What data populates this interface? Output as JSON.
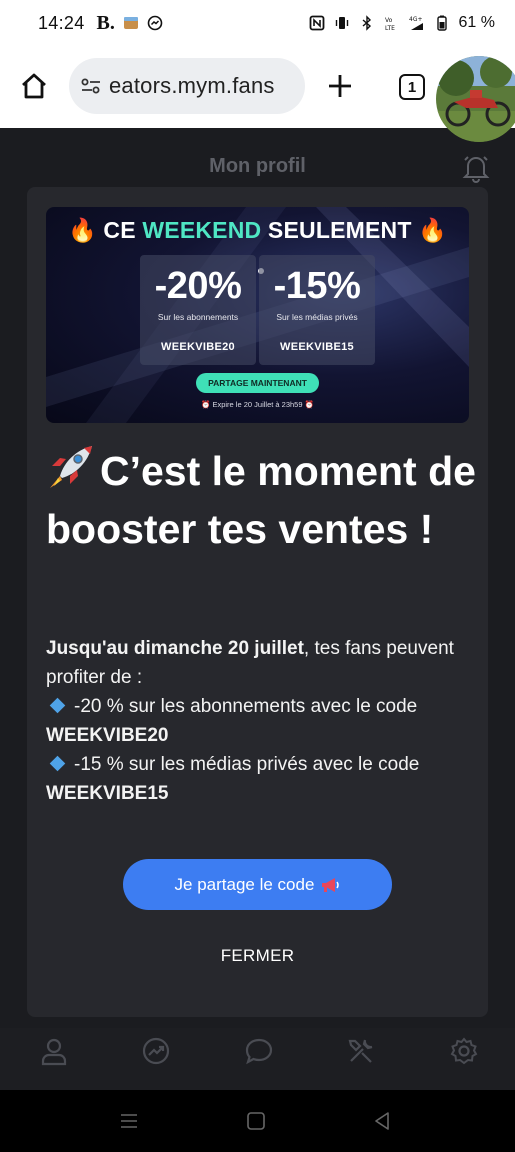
{
  "status_bar": {
    "time": "14:24",
    "letter": "B.",
    "battery": "61 %"
  },
  "browser": {
    "url": "eators.mym.fans",
    "tab_count": "1"
  },
  "app": {
    "header_title": "Mon profil"
  },
  "promo": {
    "title_pre": "CE ",
    "title_highlight": "WEEKEND",
    "title_post": " SEULEMENT",
    "card1": {
      "percent": "-20%",
      "label": "Sur les abonnements",
      "code": "WEEKVIBE20"
    },
    "card2": {
      "percent": "-15%",
      "label": "Sur les médias privés",
      "code": "WEEKVIBE15"
    },
    "share_label": "PARTAGE MAINTENANT",
    "expire": "Expire le 20 Juillet à 23h59"
  },
  "modal": {
    "headline": "C’est le moment de booster tes ventes !",
    "intro_bold": "Jusqu'au dimanche 20 juillet",
    "intro_rest": ", tes fans peuvent profiter de :",
    "item1_text": "-20 % sur les abonnements avec le code ",
    "item1_code": "WEEKVIBE20",
    "item2_text": "-15 % sur les médias privés avec le code ",
    "item2_code": "WEEKVIBE15",
    "cta_label": "Je partage le code",
    "close_label": "FERMER"
  },
  "colors": {
    "accent": "#3d7df2",
    "highlight": "#4fe6c4",
    "modal_bg": "#27282d",
    "diamond": "#4fa3e8"
  },
  "bottom_nav": {
    "icons": [
      "user-icon",
      "chart-icon",
      "chat-icon",
      "tools-icon",
      "settings-icon"
    ]
  }
}
